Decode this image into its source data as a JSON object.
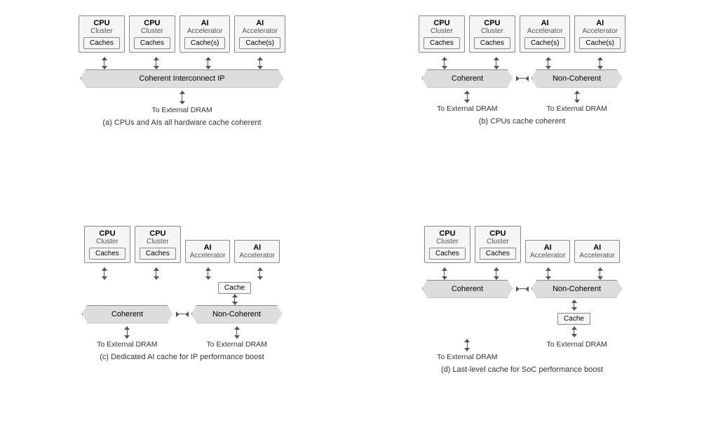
{
  "diagrams": [
    {
      "id": "a",
      "caption": "(a) CPUs and AIs all hardware cache coherent",
      "nodes": [
        {
          "title": "CPU",
          "sub": "Cluster",
          "cache": "Caches"
        },
        {
          "title": "CPU",
          "sub": "Cluster",
          "cache": "Caches"
        },
        {
          "title": "AI",
          "sub": "Accelerator",
          "cache": "Cache(s)"
        },
        {
          "title": "AI",
          "sub": "Accelerator",
          "cache": "Cache(s)"
        }
      ],
      "interconnect": "Coherent Interconnect IP",
      "dram": [
        "To External DRAM"
      ]
    },
    {
      "id": "b",
      "caption": "(b) CPUs cache coherent",
      "nodesLeft": [
        {
          "title": "CPU",
          "sub": "Cluster",
          "cache": "Caches"
        },
        {
          "title": "CPU",
          "sub": "Cluster",
          "cache": "Caches"
        }
      ],
      "nodesRight": [
        {
          "title": "AI",
          "sub": "Accelerator",
          "cache": "Cache(s)"
        },
        {
          "title": "AI",
          "sub": "Accelerator",
          "cache": "Cache(s)"
        }
      ],
      "bannerLeft": "Coherent",
      "bannerRight": "Non-Coherent",
      "dramLeft": "To External DRAM",
      "dramRight": "To External DRAM"
    },
    {
      "id": "c",
      "caption": "(c) Dedicated AI cache for IP performance boost",
      "nodesLeft": [
        {
          "title": "CPU",
          "sub": "Cluster",
          "cache": "Caches"
        },
        {
          "title": "CPU",
          "sub": "Cluster",
          "cache": "Caches"
        }
      ],
      "nodesRight": [
        {
          "title": "AI",
          "sub": "Accelerator",
          "cache": null
        },
        {
          "title": "AI",
          "sub": "Accelerator",
          "cache": null
        }
      ],
      "midCache": "Cache",
      "bannerLeft": "Coherent",
      "bannerRight": "Non-Coherent",
      "dramLeft": "To External DRAM",
      "dramRight": "To External DRAM"
    },
    {
      "id": "d",
      "caption": "(d) Last-level cache for SoC performance boost",
      "nodesLeft": [
        {
          "title": "CPU",
          "sub": "Cluster",
          "cache": "Caches"
        },
        {
          "title": "CPU",
          "sub": "Cluster",
          "cache": "Caches"
        }
      ],
      "nodesRight": [
        {
          "title": "AI",
          "sub": "Accelerator",
          "cache": null
        },
        {
          "title": "AI",
          "sub": "Accelerator",
          "cache": null
        }
      ],
      "midCache": "Cache",
      "bannerLeft": "Coherent",
      "bannerRight": "Non-Coherent",
      "dramLeft": "To External DRAM",
      "dramRight": "To External DRAM"
    }
  ]
}
